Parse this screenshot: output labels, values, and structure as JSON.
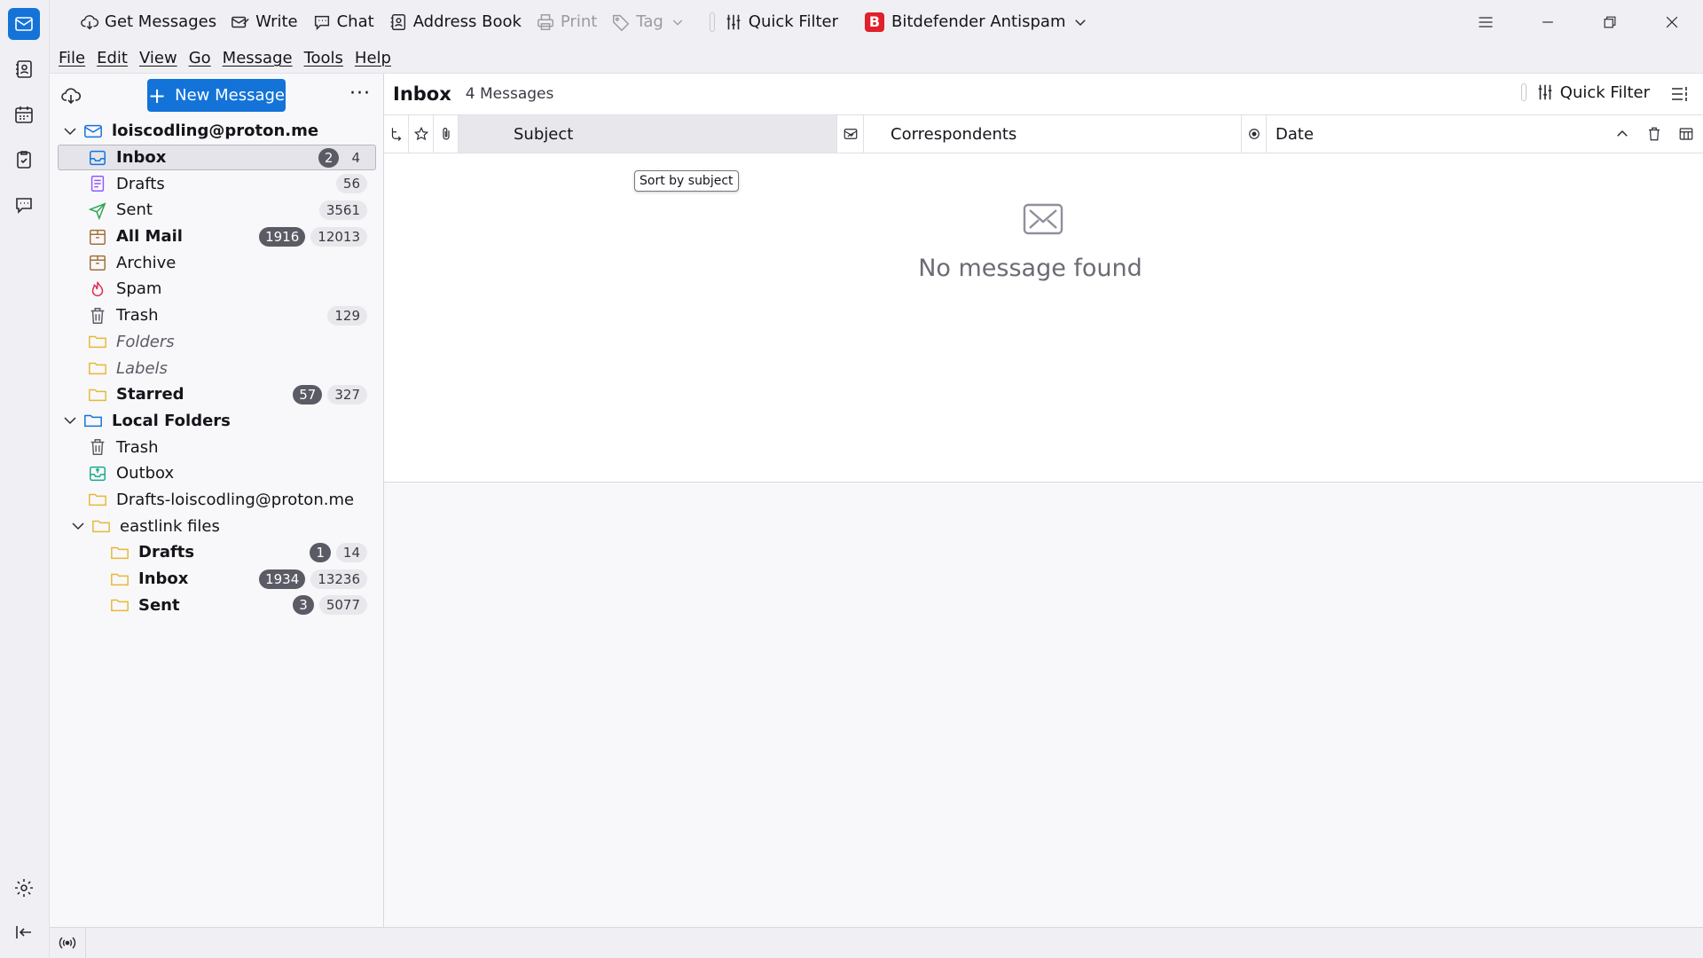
{
  "toolbar": {
    "get_messages": "Get Messages",
    "write": "Write",
    "chat": "Chat",
    "address_book": "Address Book",
    "print": "Print",
    "tag": "Tag",
    "quick_filter": "Quick Filter",
    "bitdefender_logo": "B",
    "bitdefender": "Bitdefender Antispam"
  },
  "menubar": [
    "File",
    "Edit",
    "View",
    "Go",
    "Message",
    "Tools",
    "Help"
  ],
  "folder_pane": {
    "new_message": "New Message",
    "more": "···",
    "account": "loiscodling@proton.me",
    "folders": [
      {
        "label": "Inbox",
        "unread": "2",
        "total": "4"
      },
      {
        "label": "Drafts",
        "unread": "",
        "total": "56"
      },
      {
        "label": "Sent",
        "unread": "",
        "total": "3561"
      },
      {
        "label": "All Mail",
        "unread": "1916",
        "total": "12013"
      },
      {
        "label": "Archive",
        "unread": "",
        "total": ""
      },
      {
        "label": "Spam",
        "unread": "",
        "total": ""
      },
      {
        "label": "Trash",
        "unread": "",
        "total": "129"
      },
      {
        "label": "Folders",
        "unread": "",
        "total": ""
      },
      {
        "label": "Labels",
        "unread": "",
        "total": ""
      },
      {
        "label": "Starred",
        "unread": "57",
        "total": "327"
      }
    ],
    "local_folders": "Local Folders",
    "local": [
      {
        "label": "Trash"
      },
      {
        "label": "Outbox"
      },
      {
        "label": "Drafts-loiscodling@proton.me"
      },
      {
        "label": "eastlink files"
      }
    ],
    "eastlink": [
      {
        "label": "Drafts",
        "unread": "1",
        "total": "14"
      },
      {
        "label": "Inbox",
        "unread": "1934",
        "total": "13236"
      },
      {
        "label": "Sent",
        "unread": "3",
        "total": "5077"
      }
    ]
  },
  "thread_pane": {
    "title": "Inbox",
    "count": "4 Messages",
    "quick_filter": "Quick Filter",
    "columns": {
      "subject": "Subject",
      "correspondents": "Correspondents",
      "date": "Date"
    },
    "tooltip": "Sort by subject",
    "empty": "No message found"
  },
  "colors": {
    "accent": "#1373d9",
    "bitdefender": "#e0202a"
  }
}
